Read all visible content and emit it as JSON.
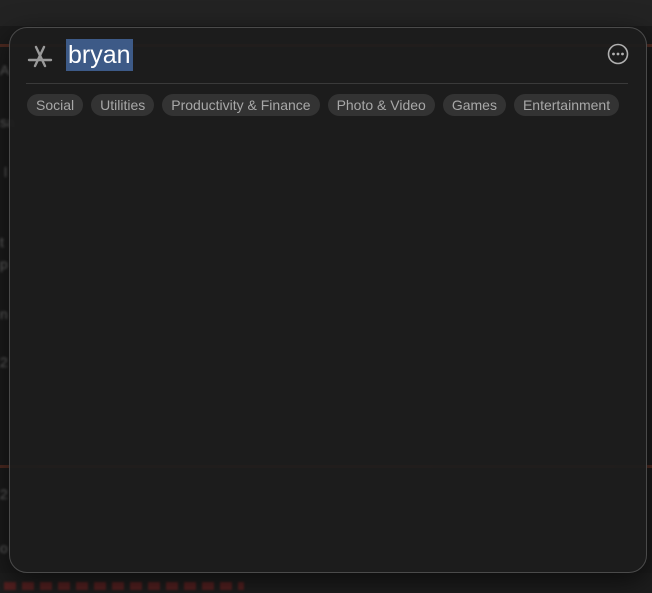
{
  "search": {
    "query": "bryan"
  },
  "categories": [
    {
      "label": "Social"
    },
    {
      "label": "Utilities"
    },
    {
      "label": "Productivity & Finance"
    },
    {
      "label": "Photo & Video"
    },
    {
      "label": "Games"
    },
    {
      "label": "Entertainment"
    }
  ],
  "background": {
    "lines": [
      {
        "text": "A"
      },
      {
        "text": "sa"
      },
      {
        "text": "l"
      },
      {
        "text": "t"
      },
      {
        "text": "p"
      },
      {
        "text": "n"
      },
      {
        "text": "2"
      },
      {
        "text": "2"
      },
      {
        "text": "o"
      }
    ]
  },
  "colors": {
    "panel_bg": "#1c1c1c",
    "selection": "#3d5a87",
    "chip_bg": "#333333",
    "chip_text": "#a8a8a8",
    "accent_line": "#7a3b2a"
  },
  "icons": {
    "launcher": "app-store-icon",
    "more": "more-options-icon"
  }
}
